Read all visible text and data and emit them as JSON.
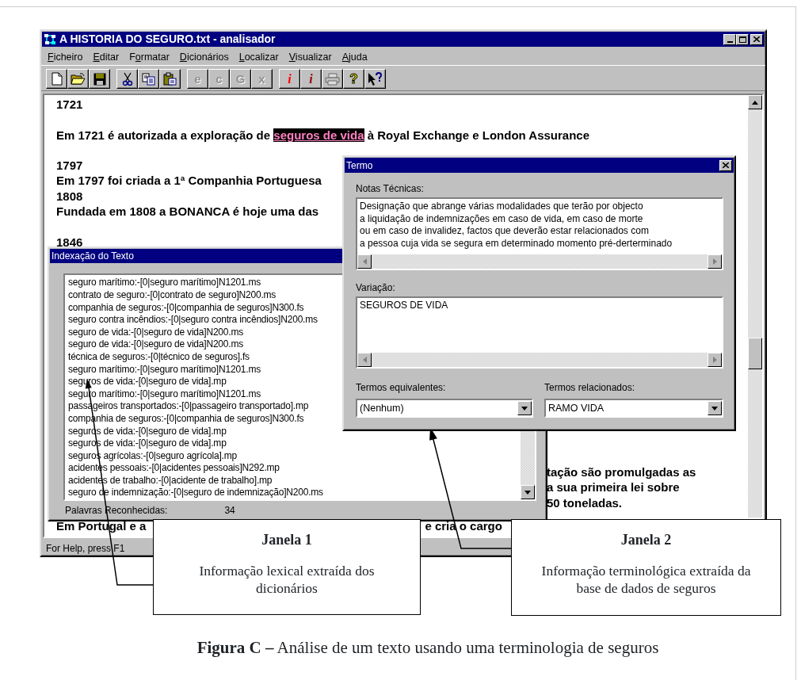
{
  "app_window": {
    "title": "A HISTORIA DO SEGURO.txt - analisador",
    "menu": [
      {
        "key": "F",
        "post": "icheiro"
      },
      {
        "key": "E",
        "post": "ditar"
      },
      {
        "pre": "F",
        "key": "o",
        "post": "rmatar"
      },
      {
        "key": "D",
        "post": "icionários"
      },
      {
        "key": "L",
        "post": "ocalizar"
      },
      {
        "key": "V",
        "post": "isualizar"
      },
      {
        "key": "A",
        "post": "juda"
      }
    ],
    "toolbar": [
      [
        {
          "kind": "icon",
          "disabled": false
        },
        {
          "kind": "icon",
          "disabled": false
        },
        {
          "kind": "icon",
          "disabled": false
        }
      ],
      [
        {
          "kind": "icon",
          "disabled": false
        },
        {
          "kind": "icon",
          "disabled": false
        },
        {
          "kind": "icon",
          "disabled": false
        }
      ],
      [
        {
          "kind": "glyph",
          "text": "e",
          "disabled": true
        },
        {
          "kind": "glyph",
          "text": "c",
          "disabled": true
        },
        {
          "kind": "glyph",
          "text": "G",
          "disabled": true
        },
        {
          "kind": "glyph",
          "text": "x",
          "disabled": true
        }
      ],
      [
        {
          "kind": "glyph",
          "text": "i",
          "disabled": false,
          "color": "#ff0000"
        },
        {
          "kind": "glyph",
          "text": "i",
          "disabled": false,
          "color": "#990000"
        },
        {
          "kind": "icon",
          "disabled": true
        },
        {
          "kind": "glyph",
          "text": "?",
          "disabled": false,
          "color": "#ffff00"
        },
        {
          "kind": "icon",
          "disabled": false
        }
      ]
    ],
    "document": [
      {
        "kind": "line",
        "text": "1721"
      },
      {
        "kind": "blank"
      },
      {
        "kind": "highlight",
        "pre": "Em 1721 é autorizada a exploração de ",
        "mark": "seguros de vida",
        "post": " à Royal Exchange e London Assurance"
      },
      {
        "kind": "blank"
      },
      {
        "kind": "line",
        "text": "1797"
      },
      {
        "kind": "line",
        "text": "Em 1797 foi criada a 1ª Companhia Portuguesa"
      },
      {
        "kind": "line",
        "text": "1808"
      },
      {
        "kind": "line",
        "text": "Fundada em 1808 a BONANCA é hoje uma das"
      },
      {
        "kind": "blank"
      },
      {
        "kind": "line",
        "text": "1846"
      },
      {
        "kind": "tail",
        "text": "tação são promulgadas as"
      },
      {
        "kind": "tail",
        "text": "a sua primeira lei sobre"
      },
      {
        "kind": "tail",
        "text": "50 toneladas."
      },
      {
        "kind": "split",
        "left": "Em Portugal e a",
        "right": "e cria o cargo"
      }
    ],
    "status_bar": "For Help, press F1"
  },
  "index_window": {
    "title": "Indexação do Texto",
    "entries": [
      "seguro marítimo:-[0|seguro marítimo]N1201.ms",
      "contrato de seguro:-[0|contrato de seguro]N200.ms",
      "companhia de seguros:-[0|companhia de seguros]N300.fs",
      "seguro contra incêndios:-[0|seguro contra incêndios]N200.ms",
      "seguro de vida:-[0|seguro de vida]N200.ms",
      "seguro de vida:-[0|seguro de vida]N200.ms",
      "técnica de seguros:-[0|técnico de seguros].fs",
      "seguro marítimo:-[0|seguro marítimo]N1201.ms",
      "seguros de vida:-[0|seguro de vida].mp",
      "seguro marítimo:-[0|seguro marítimo]N1201.ms",
      "passageiros transportados:-[0|passageiro transportado].mp",
      "companhia de seguros:-[0|companhia de seguros]N300.fs",
      "seguros de vida:-[0|seguro de vida].mp",
      "seguros de vida:-[0|seguro de vida].mp",
      "seguros agrícolas:-[0|seguro agrícola].mp",
      "acidentes pessoais:-[0|acidentes pessoais]N292.mp",
      "acidentes de trabalho:-[0|acidente de trabalho].mp",
      "seguro de indemnização:-[0|seguro de indemnização]N200.ms"
    ],
    "count_label": "Palavras Reconhecidas:",
    "count": "34"
  },
  "term_window": {
    "title": "Termo",
    "notes_label": "Notas Técnicas:",
    "notes": "Designação que abrange várias modalidades que terão por objecto\na liquidação de indemnizações em caso de vida, em caso de morte\nou em caso de invalidez, factos que deverão estar relacionados com\na pessoa cuja vida se segura em determinado momento pré-derterminado",
    "variation_label": "Variação:",
    "variation": "SEGUROS DE VIDA",
    "equivalents_label": "Termos equivalentes:",
    "equivalents_value": "(Nenhum)",
    "related_label": "Termos relacionados:",
    "related_value": "RAMO VIDA"
  },
  "callouts": [
    {
      "title": "Janela 1",
      "text": "Informação lexical extraída dos dicionários"
    },
    {
      "title": "Janela 2",
      "text": "Informação terminológica extraída da base de dados de seguros"
    }
  ],
  "caption": "**Figura C –** Análise de um texto usando uma terminologia de seguros"
}
